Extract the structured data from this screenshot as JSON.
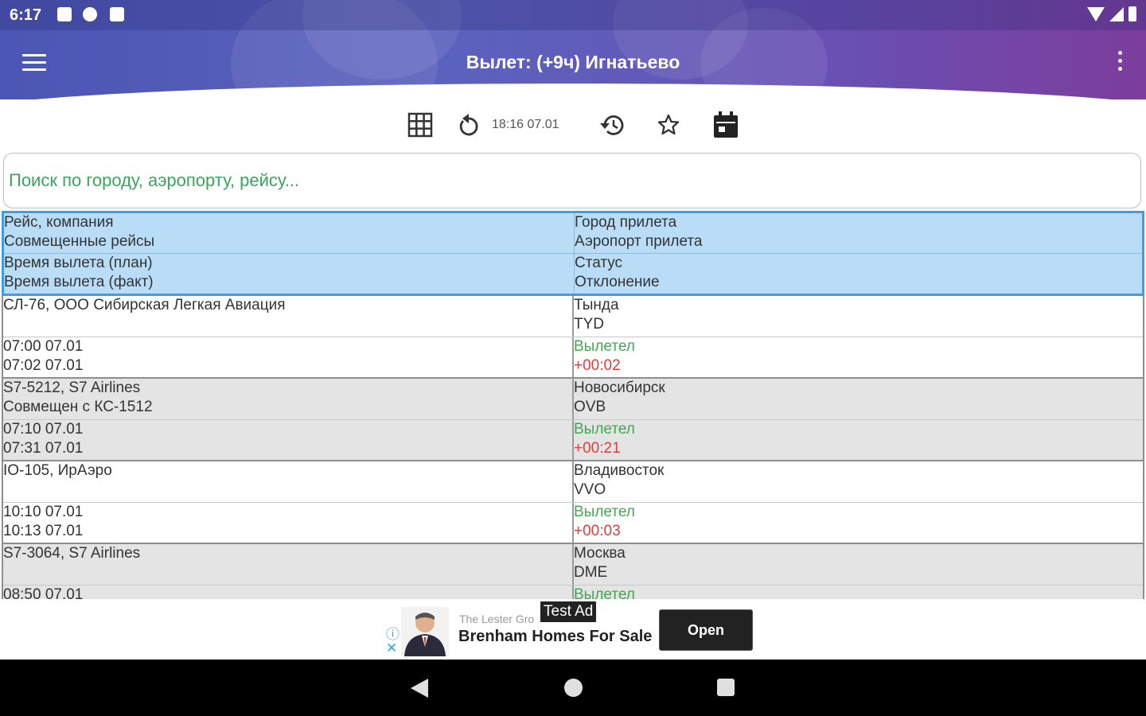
{
  "status_bar": {
    "time": "6:17",
    "icons": [
      "notification-a-icon",
      "notification-p-icon",
      "sd-card-icon",
      "wifi-icon",
      "signal-icon",
      "battery-icon"
    ]
  },
  "app_bar": {
    "title": "Вылет: (+9ч) Игнатьево",
    "menu_icon": "hamburger-menu-icon",
    "overflow_icon": "more-vert-icon"
  },
  "toolbar": {
    "update_time": "18:16 07.01",
    "icons": [
      "grid-icon",
      "refresh-icon",
      "history-icon",
      "star-icon",
      "calendar-icon"
    ]
  },
  "search": {
    "placeholder": "Поиск по городу, аэропорту, рейсу..."
  },
  "table": {
    "header": {
      "flight_company": "Рейс, компания",
      "codeshare": "Совмещенные рейсы",
      "arrival_city": "Город прилета",
      "arrival_airport": "Аэропорт прилета",
      "dep_planned": "Время вылета (план)",
      "dep_actual": "Время вылета (факт)",
      "status": "Статус",
      "deviation": "Отклонение"
    },
    "flights": [
      {
        "flight": "СЛ-76, ООО Сибирская Легкая Авиация",
        "codeshare": "",
        "city": "Тында",
        "airport": "TYD",
        "planned": "07:00 07.01",
        "actual": "07:02 07.01",
        "status": "Вылетел",
        "deviation": "+00:02"
      },
      {
        "flight": "S7-5212, S7 Airlines",
        "codeshare": "Совмещен с КС-1512",
        "city": "Новосибирск",
        "airport": "OVB",
        "planned": "07:10 07.01",
        "actual": "07:31 07.01",
        "status": "Вылетел",
        "deviation": "+00:21"
      },
      {
        "flight": "IO-105, ИрАэро",
        "codeshare": "",
        "city": "Владивосток",
        "airport": "VVO",
        "planned": "10:10 07.01",
        "actual": "10:13 07.01",
        "status": "Вылетел",
        "deviation": "+00:03"
      },
      {
        "flight": "S7-3064, S7 Airlines",
        "codeshare": "",
        "city": "Москва",
        "airport": "DME",
        "planned": "08:50 07.01",
        "actual": "",
        "status": "Вылетел",
        "deviation": ""
      }
    ]
  },
  "ad": {
    "badge": "Test Ad",
    "advertiser": "The Lester Gro",
    "title": "Brenham Homes For Sale",
    "button": "Open"
  },
  "colors": {
    "header_bg": "#b9ddf7",
    "header_border": "#3f9de8",
    "status_green": "#3faa4f",
    "deviation_red": "#e23c3c",
    "search_placeholder": "#3aa55a"
  }
}
